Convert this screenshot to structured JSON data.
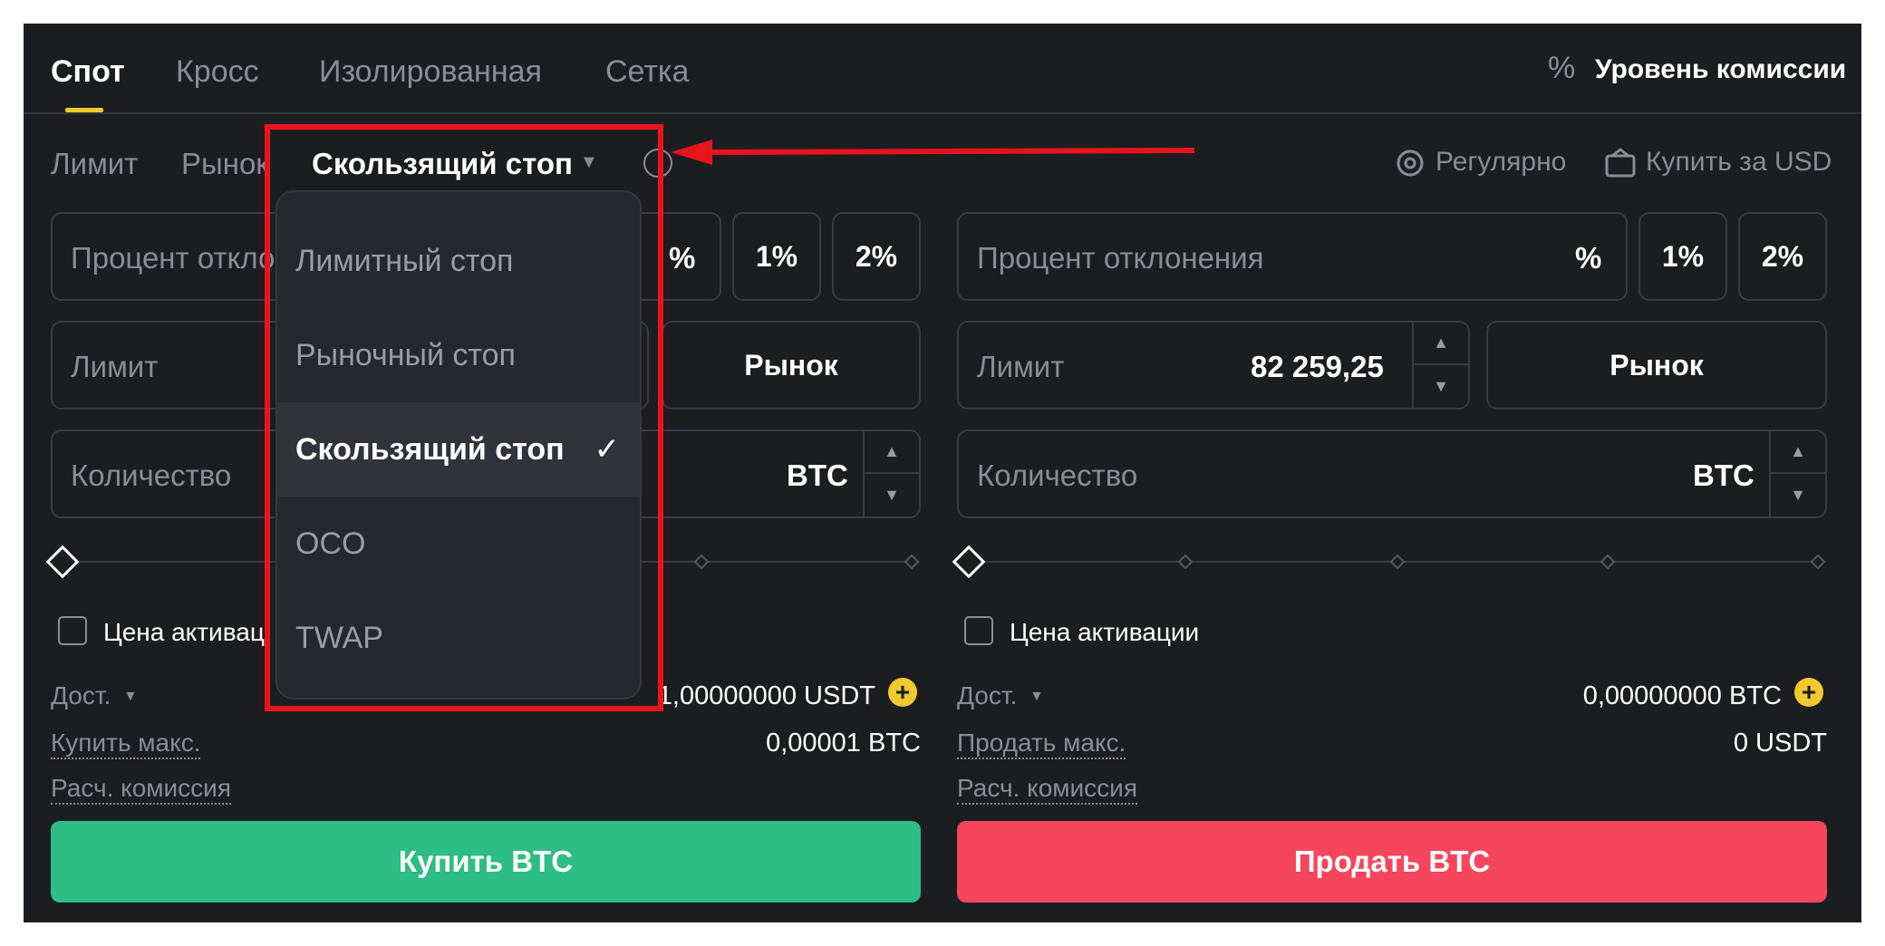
{
  "tabs": [
    "Спот",
    "Кросс",
    "Изолированная",
    "Сетка"
  ],
  "fee_level": "Уровень комиссии",
  "order_types": [
    "Лимит",
    "Рынок",
    "Скользящий стоп"
  ],
  "regular": "Регулярно",
  "buy_usd": "Купить за USD",
  "buy_panel": {
    "deviation_placeholder": "Процент откло",
    "pct_label": "%",
    "one_pct": "1%",
    "two_pct": "2%",
    "limit_placeholder": "Лимит",
    "market_btn": "Рынок",
    "qty_placeholder": "Количество",
    "qty_unit": "BTC",
    "activation_label": "Цена активац",
    "available_label": "Дост.",
    "available_value": "1,00000000 USDT",
    "max_label": "Купить макс.",
    "max_value": "0,00001 BTC",
    "fee_label": "Расч. комиссия",
    "submit": "Купить BTC"
  },
  "sell_panel": {
    "deviation_placeholder": "Процент отклонения",
    "pct_label": "%",
    "one_pct": "1%",
    "two_pct": "2%",
    "limit_placeholder": "Лимит",
    "limit_value": "82 259,25",
    "market_btn": "Рынок",
    "qty_placeholder": "Количество",
    "qty_unit": "BTC",
    "activation_label": "Цена активации",
    "available_label": "Дост.",
    "available_value": "0,00000000 BTC",
    "max_label": "Продать макс.",
    "max_value": "0 USDT",
    "fee_label": "Расч. комиссия",
    "submit": "Продать BTC"
  },
  "dropdown": {
    "items": [
      "Лимитный стоп",
      "Рыночный стоп",
      "Скользящий стоп",
      "OCO",
      "TWAP"
    ],
    "selected": "Скользящий стоп"
  },
  "colors": {
    "background": "#1c1d21",
    "accent": "#f0c930",
    "buy": "#2ebd85",
    "sell": "#f6465d",
    "annotation": "#e8141c"
  }
}
